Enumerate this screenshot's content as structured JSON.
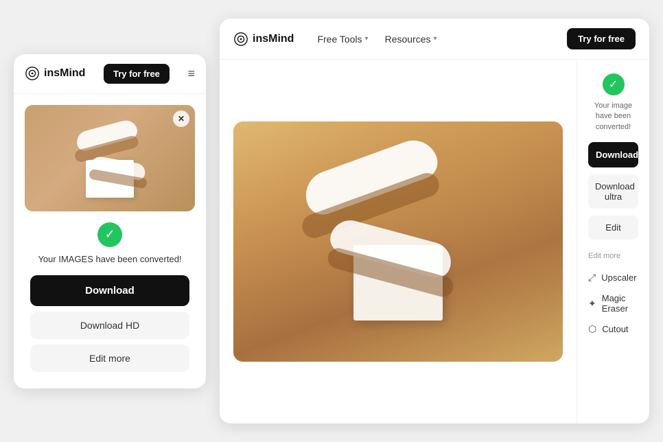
{
  "left": {
    "logo_text": "insMind",
    "try_free_label": "Try for free",
    "success_message": "Your IMAGES have been converted!",
    "download_label": "Download",
    "download_hd_label": "Download HD",
    "edit_more_label": "Edit more"
  },
  "right": {
    "logo_text": "insMind",
    "nav": {
      "free_tools": "Free Tools",
      "resources": "Resources"
    },
    "try_free_label": "Try for free",
    "success_text": "Your image have been converted!",
    "download_label": "Download",
    "download_hd_label": "Download ultra",
    "edit_label": "Edit",
    "edit_more_title": "Edit more",
    "tools": [
      {
        "name": "Upscaler",
        "icon": "⤢"
      },
      {
        "name": "Magic Eraser",
        "icon": "✦"
      },
      {
        "name": "Cutout",
        "icon": "⬡"
      }
    ]
  },
  "icons": {
    "logo_symbol": "◎",
    "check": "✓",
    "close": "✕",
    "hamburger": "≡",
    "chevron_down": "▾"
  }
}
